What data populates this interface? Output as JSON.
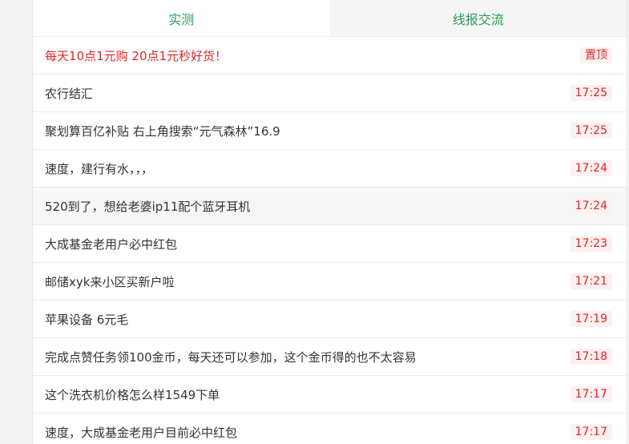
{
  "tabs": [
    {
      "label": "实测"
    },
    {
      "label": "线报交流"
    }
  ],
  "pinned": {
    "title": "每天10点1元购 20点1元秒好货！",
    "badge": "置顶"
  },
  "items": [
    {
      "title": "农行结汇",
      "time": "17:25"
    },
    {
      "title": "聚划算百亿补贴 右上角搜索“元气森林”16.9",
      "time": "17:25"
    },
    {
      "title": "速度，建行有水，，，",
      "time": "17:24"
    },
    {
      "title": "520到了，想给老婆ip11配个蓝牙耳机",
      "time": "17:24"
    },
    {
      "title": "大成基金老用户必中红包",
      "time": "17:23"
    },
    {
      "title": "邮储xyk来小区买新户啦",
      "time": "17:21"
    },
    {
      "title": "苹果设备 6元毛",
      "time": "17:19"
    },
    {
      "title": "完成点赞任务领100金币，每天还可以参加，这个金币得的也不太容易",
      "time": "17:18"
    },
    {
      "title": "这个洗衣机价格怎么样1549下单",
      "time": "17:17"
    },
    {
      "title": "速度，大成基金老用户目前必中红包",
      "time": "17:17"
    }
  ]
}
